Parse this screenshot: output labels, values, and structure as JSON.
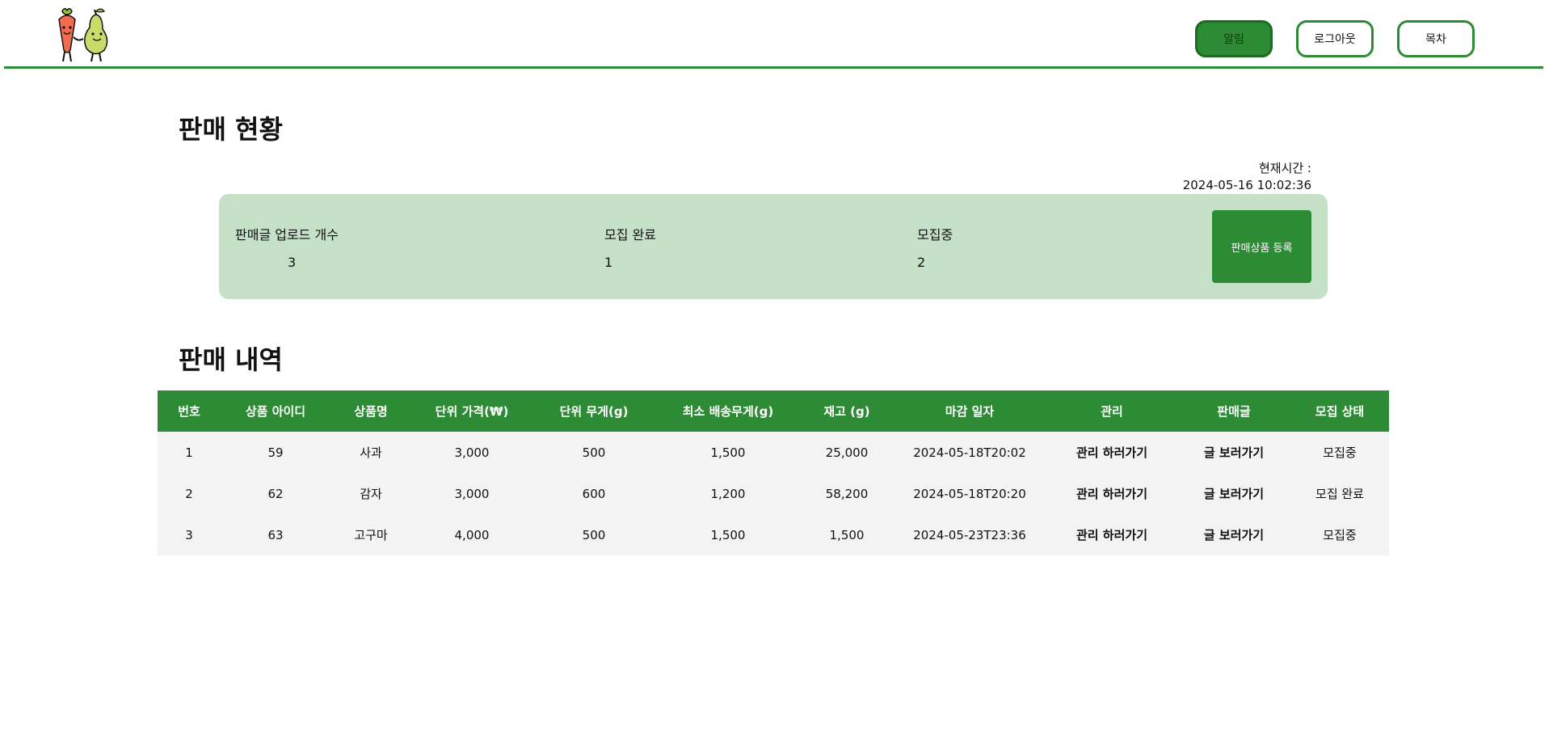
{
  "header": {
    "buttons": {
      "notifications": "알림",
      "logout": "로그아웃",
      "farm": "목차"
    }
  },
  "status_section": {
    "title": "판매 현황",
    "current_time_label": "현재시간 :",
    "current_time_value": "2024-05-16 10:02:36",
    "stats": {
      "uploaded_label": "판매글 업로드 개수",
      "uploaded_value": "3",
      "completed_label": "모집 완료",
      "completed_value": "1",
      "recruiting_label": "모집중",
      "recruiting_value": "2"
    },
    "register_button": "판매상품 등록"
  },
  "history_section": {
    "title": "판매 내역",
    "columns": {
      "no": "번호",
      "product_id": "상품 아이디",
      "product_name": "상품명",
      "unit_price": "단위 가격(₩)",
      "unit_weight": "단위 무게(g)",
      "min_shipping_weight": "최소 배송무게(g)",
      "stock": "재고 (g)",
      "deadline": "마감 일자",
      "manage": "관리",
      "post": "판매글",
      "recruit_status": "모집 상태"
    },
    "rows": [
      {
        "no": "1",
        "product_id": "59",
        "product_name": "사과",
        "unit_price": "3,000",
        "unit_weight": "500",
        "min_shipping_weight": "1,500",
        "stock": "25,000",
        "deadline": "2024-05-18T20:02",
        "manage": "관리 하러가기",
        "post": "글 보러가기",
        "recruit_status": "모집중"
      },
      {
        "no": "2",
        "product_id": "62",
        "product_name": "감자",
        "unit_price": "3,000",
        "unit_weight": "600",
        "min_shipping_weight": "1,200",
        "stock": "58,200",
        "deadline": "2024-05-18T20:20",
        "manage": "관리 하러가기",
        "post": "글 보러가기",
        "recruit_status": "모집 완료"
      },
      {
        "no": "3",
        "product_id": "63",
        "product_name": "고구마",
        "unit_price": "4,000",
        "unit_weight": "500",
        "min_shipping_weight": "1,500",
        "stock": "1,500",
        "deadline": "2024-05-23T23:36",
        "manage": "관리 하러가기",
        "post": "글 보러가기",
        "recruit_status": "모집중"
      }
    ]
  },
  "theme": {
    "accent": "#2e8b35",
    "summary_bg": "#c4e0c6",
    "row_bg": "#f3f3f3"
  },
  "icons": {
    "logo": "carrot-and-pear-logo"
  }
}
